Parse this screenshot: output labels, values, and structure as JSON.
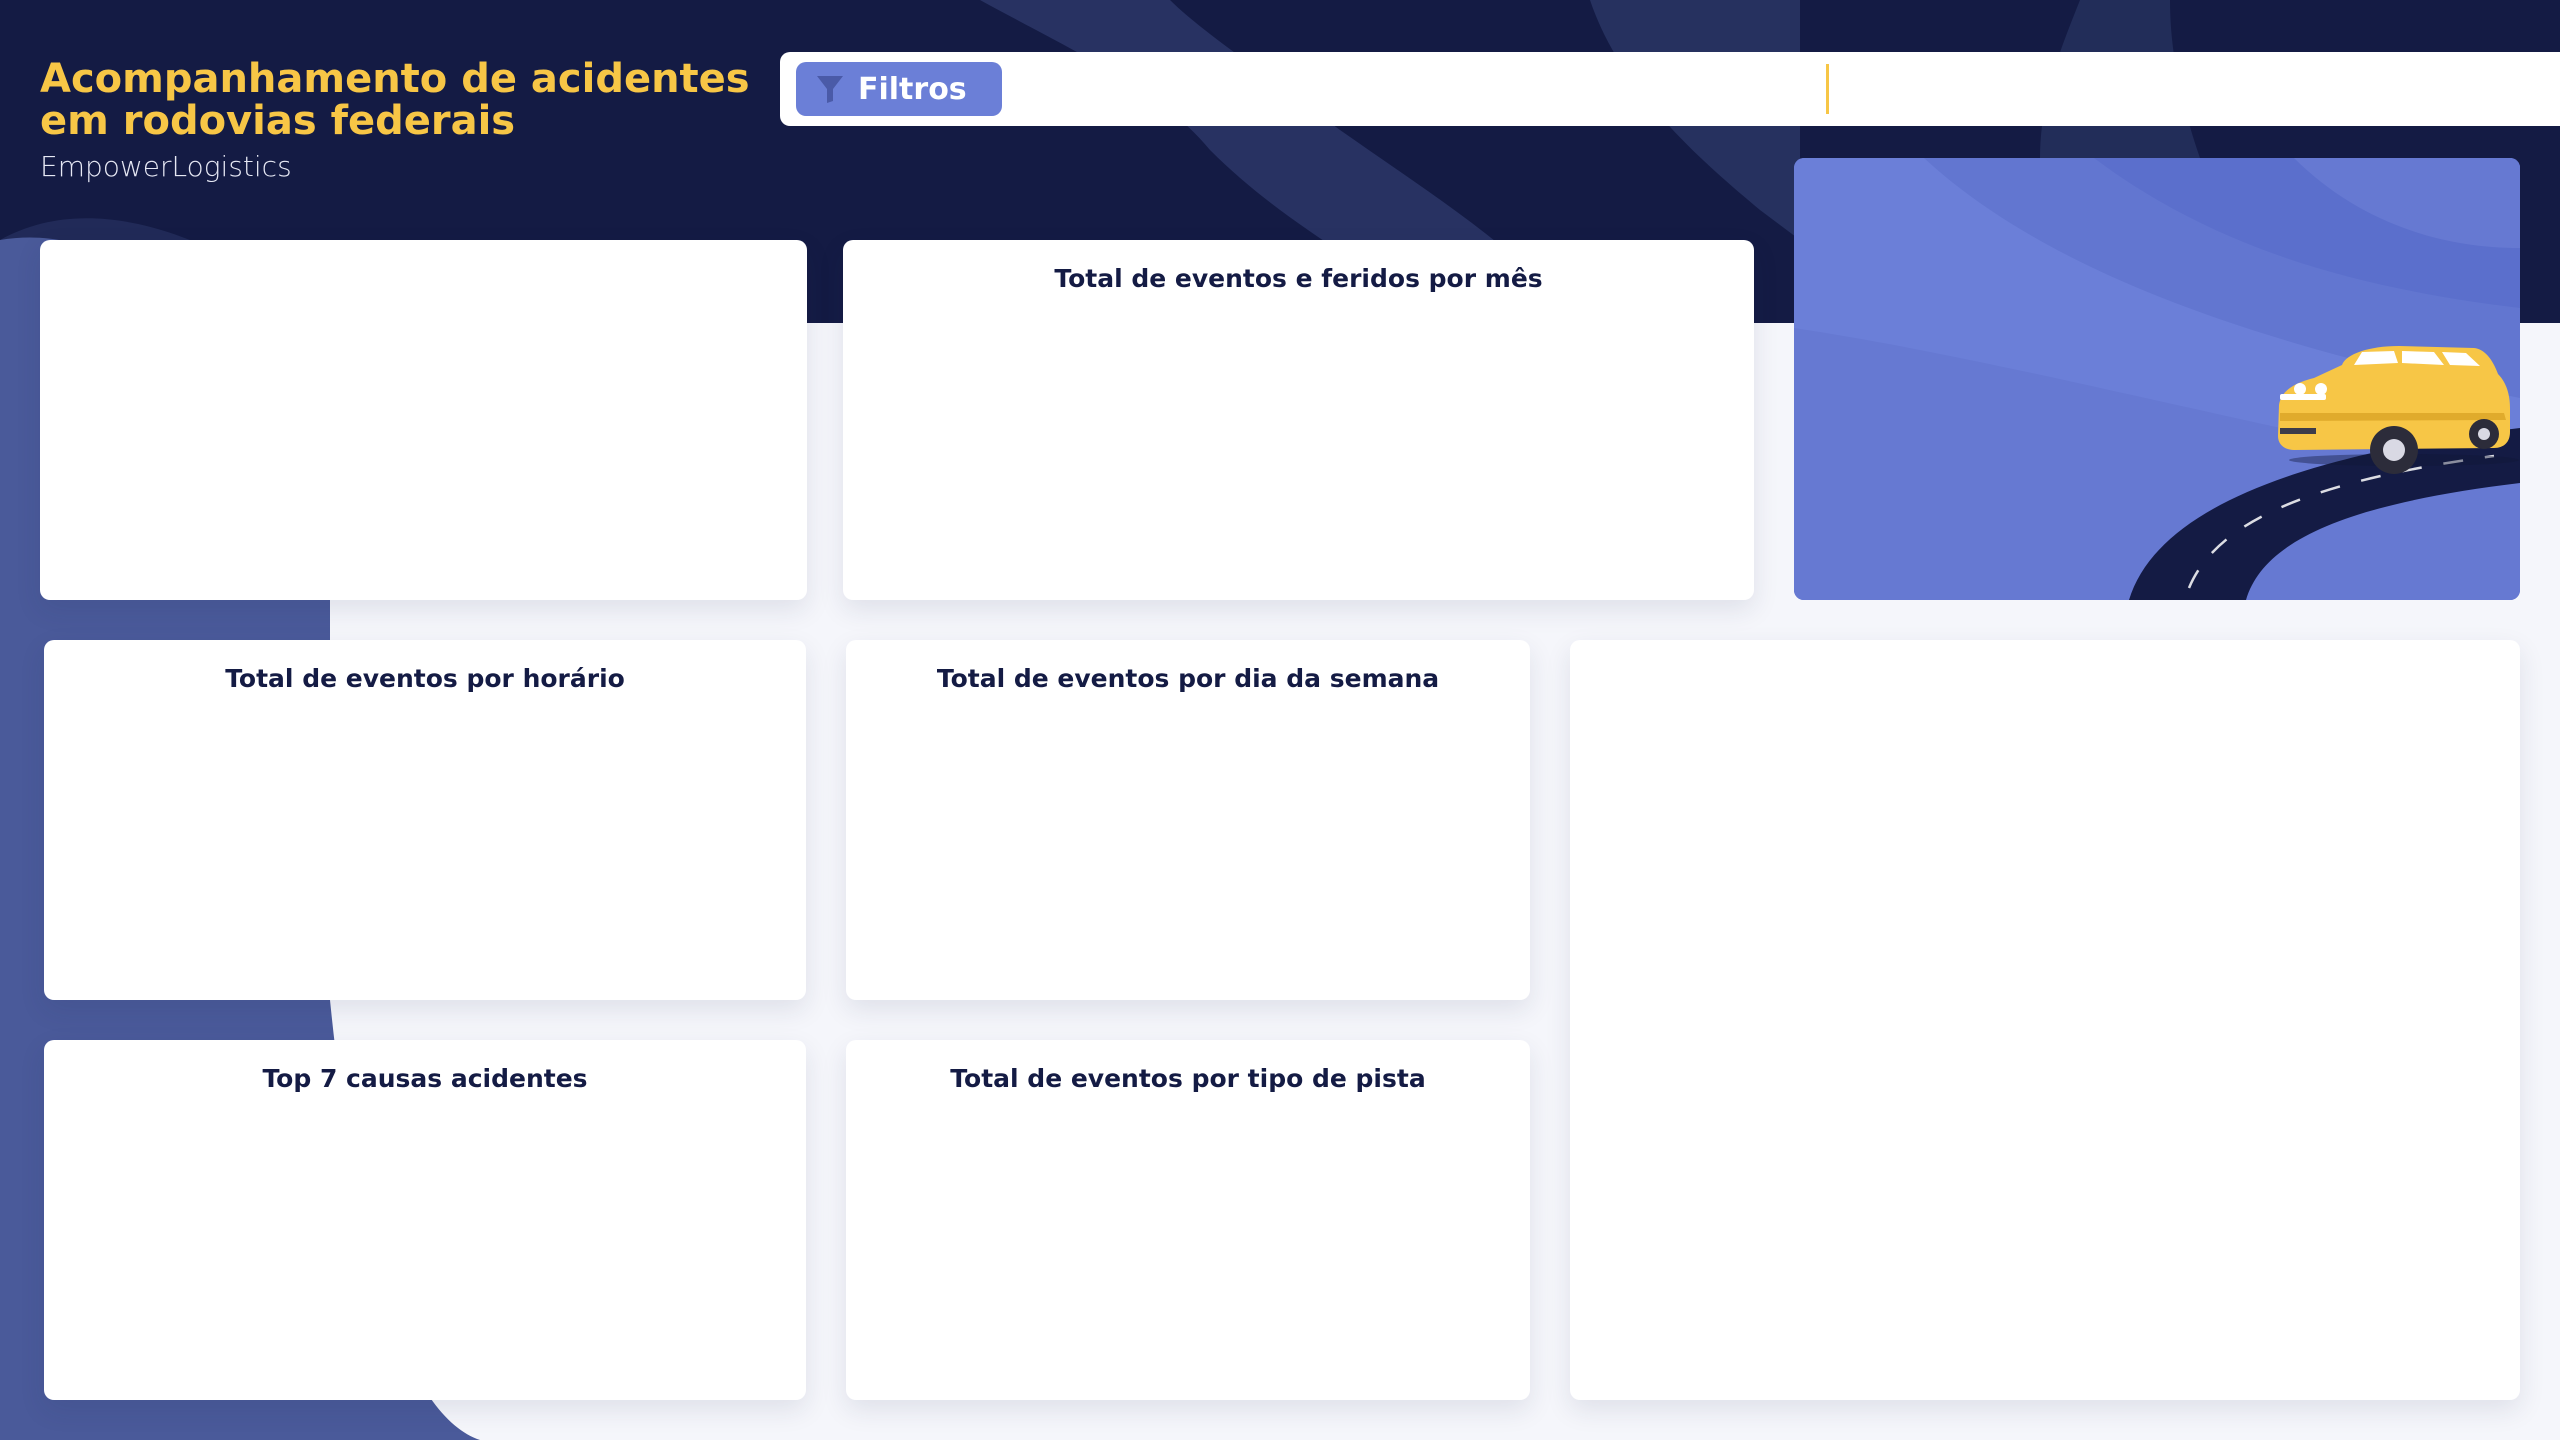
{
  "header": {
    "title_line1": "Acompanhamento de acidentes",
    "title_line2": "em rodovias federais",
    "subtitle": "EmpowerLogistics"
  },
  "filters": {
    "button_label": "Filtros"
  },
  "cards": {
    "monthly": "Total de eventos e feridos por mês",
    "hourly": "Total de eventos por horário",
    "weekday": "Total de eventos por dia da semana",
    "causes": "Top 7 causas acidentes",
    "lane_type": "Total de eventos por tipo de pista"
  },
  "colors": {
    "navy": "#141b44",
    "accent_yellow": "#f7c646",
    "periwinkle": "#6b7fd7",
    "card": "#ffffff"
  },
  "icons": {
    "filter": "filter-icon",
    "car": "car-illustration"
  }
}
